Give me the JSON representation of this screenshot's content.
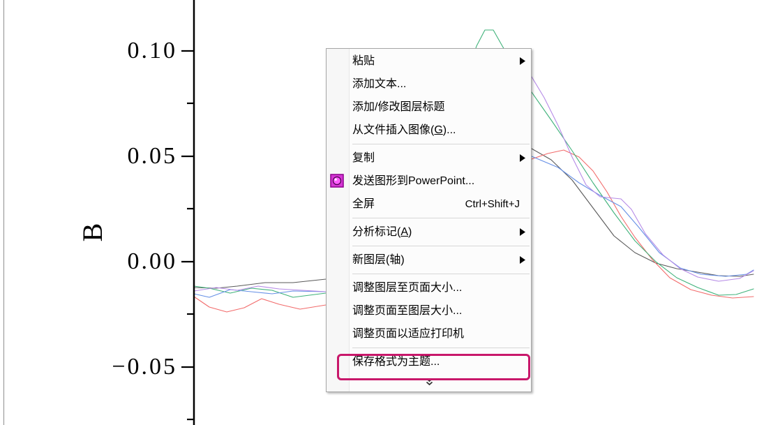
{
  "chart": {
    "y_axis_label": "B",
    "y_ticks": [
      "0.10",
      "0.05",
      "0.00",
      "−0.05"
    ],
    "series_colors": [
      "#5a5a5a",
      "#f26b6b",
      "#3fb27a",
      "#6690e6",
      "#b58ae6"
    ]
  },
  "context_menu": {
    "submenu_icon": "submenu-arrow-icon",
    "paste": {
      "label": "粘贴",
      "has_submenu": true
    },
    "add_text": {
      "label": "添加文本..."
    },
    "add_layer_title": {
      "label": "添加/修改图层标题"
    },
    "insert_image": {
      "label_before": "从文件插入图像(",
      "accel": "G",
      "label_after": ")..."
    },
    "copy": {
      "label": "复制",
      "has_submenu": true
    },
    "send_to_powerpoint": {
      "label": "发送图形到PowerPoint...",
      "icon": "powerpoint-send-icon"
    },
    "full_screen": {
      "label": "全屏",
      "shortcut": "Ctrl+Shift+J"
    },
    "analysis_markers": {
      "label_before": "分析标记(",
      "accel": "A",
      "label_after": ")",
      "has_submenu": true
    },
    "new_layer": {
      "label": "新图层(轴)",
      "has_submenu": true
    },
    "fit_layer_to_page": {
      "label": "调整图层至页面大小..."
    },
    "fit_page_to_layer": {
      "label": "调整页面至图层大小..."
    },
    "fit_page_to_printer": {
      "label": "调整页面以适应打印机"
    },
    "save_format_as_theme": {
      "label": "保存格式为主题..."
    },
    "expand_icon": "double-chevron-down-icon"
  },
  "annotation": {
    "color": "#c8176a"
  }
}
